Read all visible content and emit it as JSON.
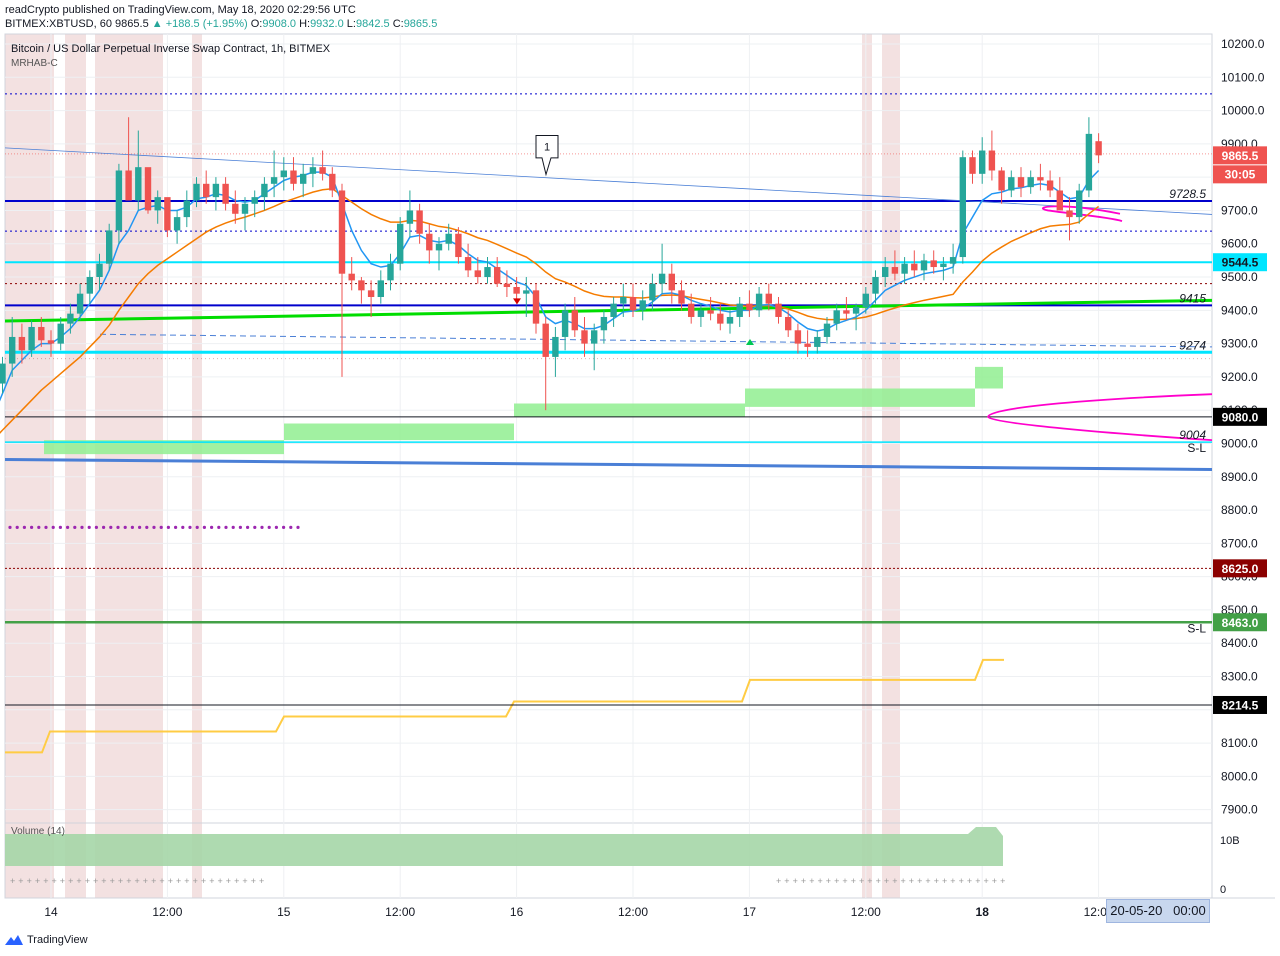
{
  "header": {
    "publisher_line": "readCrypto published on TradingView.com, May 18, 2020 02:29:56 UTC",
    "symbol_line": {
      "symbol": "BITMEX:XBTUSD, 60",
      "last": "9865.5",
      "change": "▲ +188.5 (+1.95%)",
      "o_label": "O:",
      "o": "9908.0",
      "h_label": "H:",
      "h": "9932.0",
      "l_label": "L:",
      "l": "9842.5",
      "c_label": "C:",
      "c": "9865.5"
    },
    "chart_title": "Bitcoin / US Dollar Perpetual Inverse Swap Contract, 1h, BITMEX",
    "indicator_name": "MRHAB-C"
  },
  "volume_panel": {
    "label": "Volume (14)",
    "ticks": [
      "10B",
      "0"
    ]
  },
  "footer": {
    "brand": "TradingView"
  },
  "date_badge": {
    "date": "20-05-20",
    "time": "00:00"
  },
  "colors": {
    "up": "#26a69a",
    "down": "#ef5350",
    "ema_fast": "#2196f3",
    "ema_slow": "#f57c00",
    "navy_line": "#0000cc",
    "cyan_line": "#00e5ff",
    "green_line": "#00dd00",
    "blue_line": "#4a7fd6",
    "magenta": "#ff00cc",
    "yellow_line": "#ffcc44",
    "green_band": "#90ee90",
    "dark_red": "#8b0000",
    "session": "#f2dede"
  },
  "chart_data": {
    "type": "candlestick",
    "title": "Bitcoin / US Dollar Perpetual Inverse Swap Contract, 1h, BITMEX",
    "interval": "1h",
    "ylim": [
      7860,
      10230
    ],
    "y_ticks": [
      "10200.0",
      "10100.0",
      "10000.0",
      "9900.0",
      "9800.0",
      "9700.0",
      "9600.0",
      "9500.0",
      "9400.0",
      "9300.0",
      "9200.0",
      "9100.0",
      "9000.0",
      "8900.0",
      "8800.0",
      "8700.0",
      "8600.0",
      "8500.0",
      "8400.0",
      "8300.0",
      "8200.0",
      "8100.0",
      "8000.0",
      "7900.0"
    ],
    "x_ticks": [
      {
        "label": "14",
        "day": 14,
        "hour": 0,
        "bold": false
      },
      {
        "label": "12:00",
        "day": 14,
        "hour": 12,
        "bold": false
      },
      {
        "label": "15",
        "day": 15,
        "hour": 0,
        "bold": false
      },
      {
        "label": "12:00",
        "day": 15,
        "hour": 12,
        "bold": false
      },
      {
        "label": "16",
        "day": 16,
        "hour": 0,
        "bold": false
      },
      {
        "label": "12:00",
        "day": 16,
        "hour": 12,
        "bold": false
      },
      {
        "label": "17",
        "day": 17,
        "hour": 0,
        "bold": false
      },
      {
        "label": "12:00",
        "day": 17,
        "hour": 12,
        "bold": false
      },
      {
        "label": "18",
        "day": 18,
        "hour": 0,
        "bold": true
      },
      {
        "label": "12:00",
        "day": 18,
        "hour": 12,
        "bold": false
      }
    ],
    "candles": [
      [
        9020,
        9200,
        9000,
        9180
      ],
      [
        9180,
        9260,
        9150,
        9240
      ],
      [
        9240,
        9380,
        9200,
        9320
      ],
      [
        9320,
        9360,
        9240,
        9280
      ],
      [
        9280,
        9370,
        9260,
        9350
      ],
      [
        9350,
        9380,
        9290,
        9310
      ],
      [
        9310,
        9340,
        9260,
        9300
      ],
      [
        9300,
        9380,
        9280,
        9360
      ],
      [
        9360,
        9420,
        9330,
        9390
      ],
      [
        9390,
        9480,
        9370,
        9450
      ],
      [
        9450,
        9520,
        9420,
        9500
      ],
      [
        9500,
        9570,
        9460,
        9540
      ],
      [
        9540,
        9660,
        9520,
        9640
      ],
      [
        9640,
        9840,
        9600,
        9820
      ],
      [
        9820,
        9980,
        9760,
        9730
      ],
      [
        9730,
        9940,
        9700,
        9830
      ],
      [
        9830,
        9790,
        9690,
        9700
      ],
      [
        9700,
        9760,
        9660,
        9740
      ],
      [
        9740,
        9720,
        9620,
        9640
      ],
      [
        9640,
        9700,
        9600,
        9680
      ],
      [
        9680,
        9760,
        9650,
        9730
      ],
      [
        9730,
        9800,
        9710,
        9780
      ],
      [
        9780,
        9820,
        9720,
        9740
      ],
      [
        9740,
        9800,
        9700,
        9780
      ],
      [
        9780,
        9800,
        9700,
        9720
      ],
      [
        9720,
        9760,
        9660,
        9690
      ],
      [
        9690,
        9740,
        9640,
        9720
      ],
      [
        9720,
        9760,
        9680,
        9740
      ],
      [
        9740,
        9800,
        9700,
        9780
      ],
      [
        9780,
        9880,
        9740,
        9800
      ],
      [
        9800,
        9860,
        9760,
        9820
      ],
      [
        9820,
        9860,
        9760,
        9780
      ],
      [
        9780,
        9840,
        9740,
        9810
      ],
      [
        9810,
        9860,
        9770,
        9830
      ],
      [
        9830,
        9880,
        9790,
        9810
      ],
      [
        9810,
        9830,
        9740,
        9760
      ],
      [
        9760,
        9780,
        9200,
        9510
      ],
      [
        9510,
        9560,
        9460,
        9490
      ],
      [
        9490,
        9500,
        9420,
        9460
      ],
      [
        9460,
        9490,
        9380,
        9440
      ],
      [
        9440,
        9520,
        9420,
        9490
      ],
      [
        9490,
        9570,
        9460,
        9540
      ],
      [
        9540,
        9680,
        9520,
        9660
      ],
      [
        9660,
        9760,
        9620,
        9700
      ],
      [
        9700,
        9720,
        9600,
        9630
      ],
      [
        9630,
        9660,
        9540,
        9580
      ],
      [
        9580,
        9620,
        9520,
        9600
      ],
      [
        9600,
        9660,
        9580,
        9630
      ],
      [
        9630,
        9650,
        9540,
        9560
      ],
      [
        9560,
        9600,
        9500,
        9520
      ],
      [
        9520,
        9560,
        9480,
        9500
      ],
      [
        9500,
        9560,
        9480,
        9530
      ],
      [
        9530,
        9560,
        9470,
        9480
      ],
      [
        9480,
        9520,
        9440,
        9470
      ],
      [
        9470,
        9500,
        9420,
        9450
      ],
      [
        9450,
        9500,
        9380,
        9460
      ],
      [
        9460,
        9480,
        9330,
        9360
      ],
      [
        9360,
        9380,
        9100,
        9260
      ],
      [
        9260,
        9350,
        9200,
        9320
      ],
      [
        9320,
        9420,
        9280,
        9400
      ],
      [
        9400,
        9440,
        9320,
        9340
      ],
      [
        9340,
        9380,
        9260,
        9300
      ],
      [
        9300,
        9360,
        9220,
        9340
      ],
      [
        9340,
        9400,
        9300,
        9380
      ],
      [
        9380,
        9440,
        9350,
        9420
      ],
      [
        9420,
        9480,
        9380,
        9440
      ],
      [
        9440,
        9480,
        9380,
        9400
      ],
      [
        9400,
        9460,
        9370,
        9430
      ],
      [
        9430,
        9510,
        9400,
        9480
      ],
      [
        9480,
        9600,
        9450,
        9510
      ],
      [
        9510,
        9540,
        9420,
        9460
      ],
      [
        9460,
        9490,
        9400,
        9420
      ],
      [
        9420,
        9450,
        9360,
        9380
      ],
      [
        9380,
        9420,
        9350,
        9400
      ],
      [
        9400,
        9440,
        9370,
        9390
      ],
      [
        9390,
        9420,
        9340,
        9360
      ],
      [
        9360,
        9400,
        9330,
        9380
      ],
      [
        9380,
        9440,
        9350,
        9420
      ],
      [
        9420,
        9460,
        9380,
        9400
      ],
      [
        9400,
        9470,
        9380,
        9450
      ],
      [
        9450,
        9480,
        9400,
        9420
      ],
      [
        9420,
        9440,
        9360,
        9380
      ],
      [
        9380,
        9400,
        9320,
        9340
      ],
      [
        9340,
        9360,
        9270,
        9300
      ],
      [
        9300,
        9340,
        9260,
        9290
      ],
      [
        9290,
        9340,
        9270,
        9320
      ],
      [
        9320,
        9380,
        9300,
        9360
      ],
      [
        9360,
        9420,
        9340,
        9400
      ],
      [
        9400,
        9440,
        9370,
        9390
      ],
      [
        9390,
        9420,
        9340,
        9410
      ],
      [
        9410,
        9470,
        9390,
        9450
      ],
      [
        9450,
        9520,
        9420,
        9500
      ],
      [
        9500,
        9560,
        9470,
        9530
      ],
      [
        9530,
        9580,
        9490,
        9510
      ],
      [
        9510,
        9560,
        9480,
        9540
      ],
      [
        9540,
        9580,
        9500,
        9520
      ],
      [
        9520,
        9570,
        9490,
        9550
      ],
      [
        9550,
        9580,
        9510,
        9530
      ],
      [
        9530,
        9560,
        9490,
        9540
      ],
      [
        9540,
        9600,
        9510,
        9560
      ],
      [
        9560,
        9880,
        9540,
        9860
      ],
      [
        9860,
        9880,
        9780,
        9810
      ],
      [
        9810,
        9920,
        9780,
        9880
      ],
      [
        9880,
        9940,
        9790,
        9820
      ],
      [
        9820,
        9830,
        9720,
        9760
      ],
      [
        9760,
        9820,
        9740,
        9800
      ],
      [
        9800,
        9830,
        9740,
        9770
      ],
      [
        9770,
        9820,
        9750,
        9800
      ],
      [
        9800,
        9840,
        9760,
        9790
      ],
      [
        9790,
        9820,
        9740,
        9760
      ],
      [
        9760,
        9800,
        9720,
        9700
      ],
      [
        9700,
        9740,
        9610,
        9680
      ],
      [
        9680,
        9780,
        9660,
        9760
      ],
      [
        9760,
        9980,
        9740,
        9930
      ],
      [
        9908,
        9932,
        9842,
        9865.5
      ]
    ],
    "ema_fast": [
      9080,
      9150,
      9220,
      9250,
      9280,
      9300,
      9300,
      9320,
      9345,
      9380,
      9420,
      9460,
      9520,
      9600,
      9640,
      9700,
      9710,
      9715,
      9700,
      9700,
      9710,
      9735,
      9740,
      9750,
      9745,
      9730,
      9725,
      9730,
      9750,
      9770,
      9790,
      9800,
      9805,
      9815,
      9815,
      9800,
      9720,
      9640,
      9580,
      9540,
      9530,
      9535,
      9570,
      9620,
      9625,
      9610,
      9605,
      9610,
      9595,
      9570,
      9550,
      9545,
      9525,
      9505,
      9485,
      9475,
      9440,
      9380,
      9360,
      9370,
      9360,
      9345,
      9345,
      9355,
      9375,
      9395,
      9398,
      9405,
      9425,
      9450,
      9452,
      9445,
      9430,
      9420,
      9412,
      9400,
      9395,
      9400,
      9400,
      9415,
      9417,
      9408,
      9390,
      9365,
      9345,
      9338,
      9344,
      9360,
      9370,
      9380,
      9400,
      9430,
      9460,
      9475,
      9490,
      9500,
      9510,
      9515,
      9520,
      9530,
      9630,
      9680,
      9730,
      9750,
      9755,
      9765,
      9768,
      9775,
      9780,
      9775,
      9755,
      9735,
      9740,
      9790,
      9820
    ],
    "ema_slow": [
      9010,
      9040,
      9070,
      9100,
      9130,
      9160,
      9185,
      9210,
      9235,
      9260,
      9290,
      9320,
      9355,
      9400,
      9440,
      9480,
      9510,
      9535,
      9555,
      9575,
      9595,
      9615,
      9635,
      9650,
      9662,
      9672,
      9680,
      9690,
      9700,
      9712,
      9725,
      9735,
      9745,
      9755,
      9762,
      9765,
      9745,
      9725,
      9705,
      9688,
      9675,
      9665,
      9665,
      9670,
      9668,
      9660,
      9652,
      9648,
      9640,
      9630,
      9618,
      9610,
      9598,
      9585,
      9572,
      9560,
      9540,
      9515,
      9495,
      9485,
      9472,
      9458,
      9448,
      9442,
      9440,
      9440,
      9438,
      9437,
      9440,
      9445,
      9446,
      9444,
      9438,
      9433,
      9428,
      9422,
      9416,
      9414,
      9412,
      9414,
      9414,
      9411,
      9404,
      9394,
      9383,
      9376,
      9372,
      9372,
      9373,
      9375,
      9380,
      9388,
      9398,
      9407,
      9416,
      9423,
      9430,
      9436,
      9442,
      9448,
      9485,
      9515,
      9548,
      9572,
      9590,
      9607,
      9620,
      9633,
      9645,
      9653,
      9656,
      9658,
      9665,
      9690,
      9712
    ],
    "horizontal_levels": [
      {
        "label": "9728.5",
        "value": 9728.5,
        "style": "navy"
      },
      {
        "label": "9544.5",
        "value": 9544.5,
        "style": "cyan",
        "badge": true
      },
      {
        "label": "9415",
        "value": 9415,
        "style": "navy"
      },
      {
        "label": "9274",
        "value": 9274,
        "style": "cyan"
      },
      {
        "label": "9080.0",
        "value": 9080,
        "style": "black",
        "badge": true
      },
      {
        "label": "9004",
        "value": 9004,
        "style": "cyan"
      },
      {
        "label": "8625.0",
        "value": 8625,
        "style": "darkred-dotted",
        "badge": true
      },
      {
        "label": "8463.0",
        "value": 8463,
        "style": "green",
        "badge": true
      },
      {
        "label": "8214.5",
        "value": 8214.5,
        "style": "black",
        "badge": true
      }
    ],
    "sl_labels": [
      {
        "label": "S-L",
        "value": 9004
      },
      {
        "label": "S-L",
        "value": 8463
      }
    ],
    "current_price": {
      "label": "9865.5",
      "value": 9865.5,
      "countdown": "30:05"
    },
    "annotation_number": "1"
  }
}
